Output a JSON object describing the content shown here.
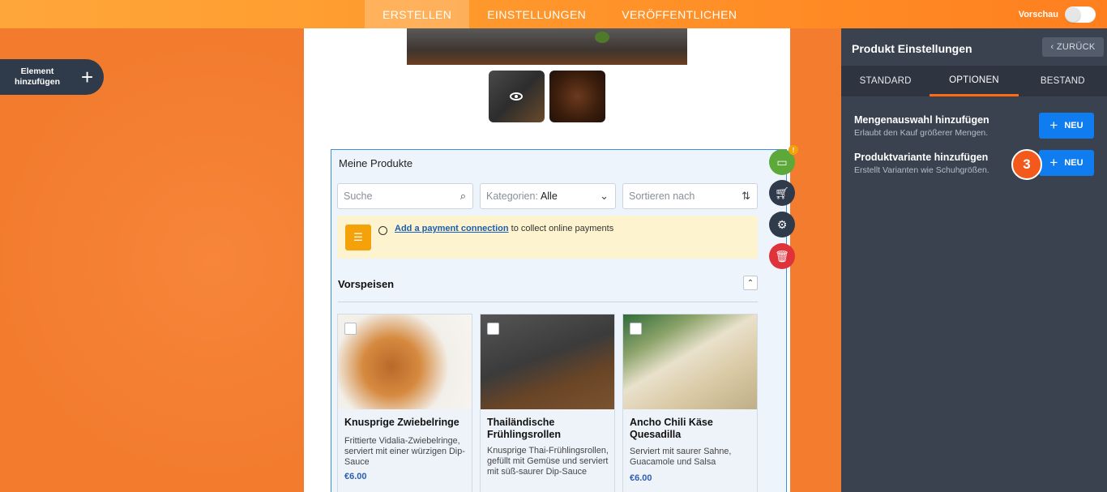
{
  "topbar": {
    "tabs": [
      {
        "label": "ERSTELLEN",
        "active": true
      },
      {
        "label": "EINSTELLUNGEN",
        "active": false
      },
      {
        "label": "VERÖFFENTLICHEN",
        "active": false
      }
    ],
    "preview_label": "Vorschau",
    "preview_enabled": false
  },
  "left": {
    "add_element_label": "Element hinzufügen"
  },
  "products_widget": {
    "title": "Meine Produkte",
    "search_placeholder": "Suche",
    "category_label": "Kategorien:",
    "category_value": "Alle",
    "sort_label": "Sortieren nach",
    "notice_link": "Add a payment connection",
    "notice_text": " to collect online payments",
    "section_title": "Vorspeisen",
    "products": [
      {
        "name": "Knusprige Zwiebelringe",
        "description": "Frittierte Vidalia-Zwiebelringe, serviert mit einer würzigen Dip-Sauce",
        "price": "€6.00"
      },
      {
        "name": "Thailändische Frühlingsrollen",
        "description": "Knusprige Thai-Frühlingsrollen, gefüllt mit Gemüse und serviert mit süß-saurer Dip-Sauce",
        "price": ""
      },
      {
        "name": "Ancho Chili Käse Quesadilla",
        "description": "Serviert mit saurer Sahne, Guacamole und Salsa",
        "price": "€6.00"
      }
    ]
  },
  "tools": {
    "payment_badge": "!"
  },
  "panel": {
    "title": "Produkt Einstellungen",
    "back_label": "ZURÜCK",
    "tabs": [
      {
        "label": "STANDARD",
        "active": false
      },
      {
        "label": "OPTIONEN",
        "active": true
      },
      {
        "label": "BESTAND",
        "active": false
      }
    ],
    "options": [
      {
        "title": "Mengenauswahl hinzufügen",
        "description": "Erlaubt den Kauf größerer Mengen.",
        "button": "NEU"
      },
      {
        "title": "Produktvariante hinzufügen",
        "description": "Erstellt Varianten wie Schuhgrößen.",
        "button": "NEU"
      }
    ],
    "step_marker": "3"
  },
  "colors": {
    "accent_orange": "#ff7f1f",
    "panel_bg": "#3a4250",
    "button_blue": "#0f7cf0",
    "step_orange": "#f2591b"
  }
}
